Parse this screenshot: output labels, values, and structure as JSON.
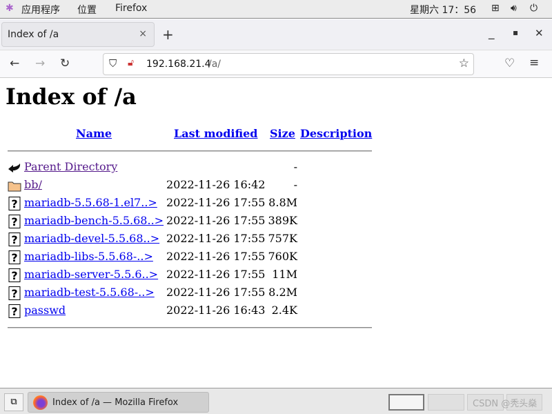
{
  "topbar": {
    "apps": "应用程序",
    "places": "位置",
    "app_name": "Firefox",
    "clock": "星期六 17：56"
  },
  "tab": {
    "title": "Index of /a"
  },
  "navbar": {
    "url_host": "192.168.21.4",
    "url_path": "/a/"
  },
  "page": {
    "title": "Index of /a",
    "headers": {
      "name": "Name",
      "modified": "Last modified",
      "size": "Size",
      "description": "Description"
    },
    "rows": [
      {
        "icon": "back-icon",
        "name": "Parent Directory",
        "modified": "",
        "size": "-",
        "visited": true
      },
      {
        "icon": "folder-icon",
        "name": "bb/",
        "modified": "2022-11-26 16:42",
        "size": "-",
        "visited": true
      },
      {
        "icon": "unknown-file-icon",
        "name": "mariadb-5.5.68-1.el7..>",
        "modified": "2022-11-26 17:55",
        "size": "8.8M"
      },
      {
        "icon": "unknown-file-icon",
        "name": "mariadb-bench-5.5.68..>",
        "modified": "2022-11-26 17:55",
        "size": "389K"
      },
      {
        "icon": "unknown-file-icon",
        "name": "mariadb-devel-5.5.68..>",
        "modified": "2022-11-26 17:55",
        "size": "757K"
      },
      {
        "icon": "unknown-file-icon",
        "name": "mariadb-libs-5.5.68-..>",
        "modified": "2022-11-26 17:55",
        "size": "760K"
      },
      {
        "icon": "unknown-file-icon",
        "name": "mariadb-server-5.5.6..>",
        "modified": "2022-11-26 17:55",
        "size": "11M"
      },
      {
        "icon": "unknown-file-icon",
        "name": "mariadb-test-5.5.68-..>",
        "modified": "2022-11-26 17:55",
        "size": "8.2M"
      },
      {
        "icon": "unknown-file-icon",
        "name": "passwd",
        "modified": "2022-11-26 16:43",
        "size": "2.4K"
      }
    ]
  },
  "taskbar": {
    "window_label": "Index of /a — Mozilla Firefox",
    "watermark": "CSDN @秃头燊"
  },
  "colors": {
    "link": "#0000ee",
    "visited": "#551a8b"
  }
}
